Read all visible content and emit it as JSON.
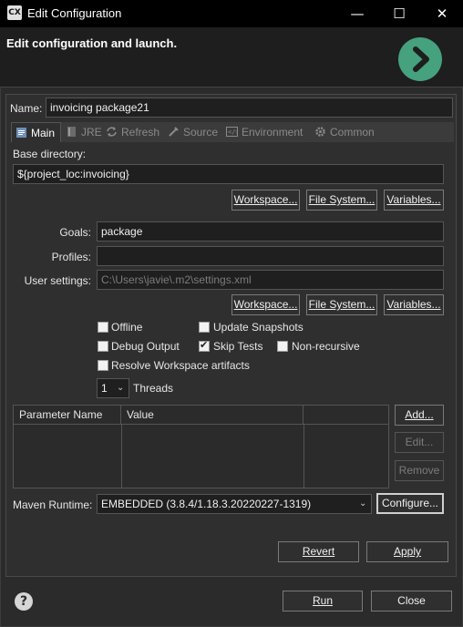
{
  "window": {
    "app_icon": "CX",
    "title": "Edit Configuration",
    "controls": {
      "minimize": "—",
      "maximize": "☐",
      "close": "✕"
    }
  },
  "header": {
    "text": "Edit configuration and launch.",
    "logo_icon": "run-arrow-icon",
    "logo_color": "#45a17e"
  },
  "name": {
    "label": "Name:",
    "value": "invoicing package21"
  },
  "tabs": [
    {
      "label": "Main",
      "icon": "main-tab-icon"
    },
    {
      "label": "JRE",
      "icon": "jre-icon"
    },
    {
      "label": "Refresh",
      "icon": "refresh-icon"
    },
    {
      "label": "Source",
      "icon": "source-icon"
    },
    {
      "label": "Environment",
      "icon": "environment-icon"
    },
    {
      "label": "Common",
      "icon": "common-icon"
    }
  ],
  "base_directory": {
    "label": "Base directory:",
    "value": "${project_loc:invoicing}",
    "workspace": "Workspace...",
    "file_system": "File System...",
    "variables": "Variables..."
  },
  "goals": {
    "label": "Goals:",
    "value": "package"
  },
  "profiles": {
    "label": "Profiles:",
    "value": ""
  },
  "user_settings": {
    "label": "User settings:",
    "value": "C:\\Users\\javie\\.m2\\settings.xml",
    "workspace": "Workspace...",
    "file_system": "File System...",
    "variables": "Variables..."
  },
  "options": {
    "offline": {
      "label": "Offline",
      "checked": false
    },
    "update_snapshots": {
      "label": "Update Snapshots",
      "checked": false
    },
    "debug_output": {
      "label": "Debug Output",
      "checked": false
    },
    "skip_tests": {
      "label": "Skip Tests",
      "checked": true
    },
    "non_recursive": {
      "label": "Non-recursive",
      "checked": false
    },
    "resolve_workspace": {
      "label": "Resolve Workspace artifacts",
      "checked": false
    }
  },
  "threads": {
    "value": "1",
    "label": "Threads"
  },
  "parameters": {
    "columns": [
      "Parameter Name",
      "Value"
    ],
    "rows": [],
    "add": "Add...",
    "edit": "Edit...",
    "remove": "Remove"
  },
  "maven_runtime": {
    "label": "Maven Runtime:",
    "value": "EMBEDDED (3.8.4/1.18.3.20220227-1319)",
    "configure": "Configure..."
  },
  "footer": {
    "revert": "Revert",
    "apply": "Apply",
    "run": "Run",
    "close": "Close",
    "help": "?"
  }
}
